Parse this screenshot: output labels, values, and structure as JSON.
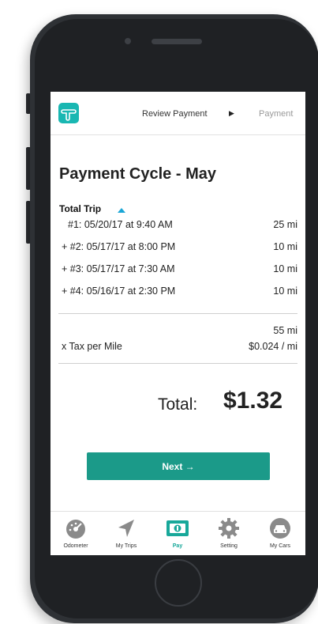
{
  "header": {
    "breadcrumb_step1": "Review Payment",
    "breadcrumb_step2": "Payment"
  },
  "page": {
    "title": "Payment Cycle - May",
    "section_label": "Total Trip"
  },
  "trips": [
    {
      "label": "#1: 05/20/17 at 9:40 AM",
      "distance": "25 mi"
    },
    {
      "label": "+ #2: 05/17/17 at 8:00 PM",
      "distance": "10 mi"
    },
    {
      "label": "+ #3: 05/17/17 at 7:30 AM",
      "distance": "10 mi"
    },
    {
      "label": "+ #4: 05/16/17 at 2:30 PM",
      "distance": "10 mi"
    }
  ],
  "summary": {
    "total_distance": "55 mi",
    "tax_label": "x Tax per Mile",
    "tax_value": "$0.024  / mi",
    "total_label": "Total:",
    "total_value": "$1.32"
  },
  "actions": {
    "next_label": "Next →"
  },
  "tabs": [
    {
      "label": "Odometer",
      "icon": "gauge-icon"
    },
    {
      "label": "My Trips",
      "icon": "navigation-arrow-icon"
    },
    {
      "label": "Pay",
      "icon": "money-bill-icon"
    },
    {
      "label": "Setting",
      "icon": "gear-icon"
    },
    {
      "label": "My Cars",
      "icon": "car-icon"
    }
  ],
  "colors": {
    "accent": "#1b9a89",
    "logo": "#19b7b2",
    "sort_caret": "#1aa6d6",
    "icon_gray": "#8a8a8a"
  }
}
